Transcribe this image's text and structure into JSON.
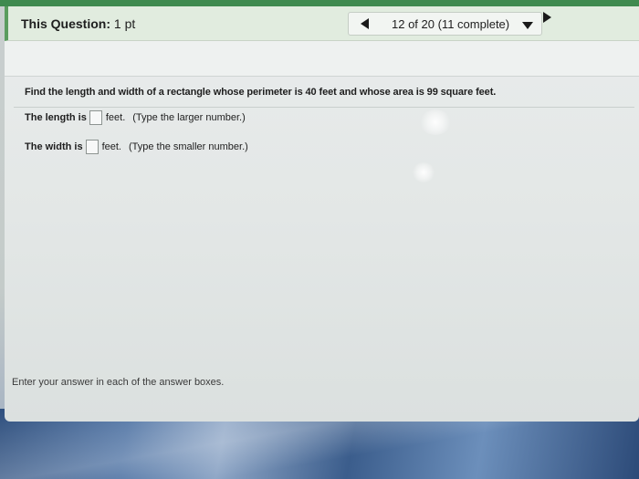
{
  "header": {
    "label": "This Question:",
    "points": "1 pt",
    "progress": "12 of 20 (11 complete)"
  },
  "question": {
    "prompt": "Find the length and width of a rectangle whose perimeter is 40 feet and whose area is 99 square feet.",
    "length": {
      "label": "The length is",
      "unit": "feet.",
      "hint": "(Type the larger number.)",
      "value": ""
    },
    "width": {
      "label": "The width is",
      "unit": "feet.",
      "hint": "(Type the smaller number.)",
      "value": ""
    }
  },
  "footer": {
    "instructions": "Enter your answer in each of the answer boxes."
  },
  "icons": {
    "prev": "left-triangle-icon",
    "next": "right-triangle-icon",
    "dropdown": "caret-down-icon"
  },
  "colors": {
    "header_accent": "#5a9c5e",
    "header_bg": "#e1ecdf"
  }
}
